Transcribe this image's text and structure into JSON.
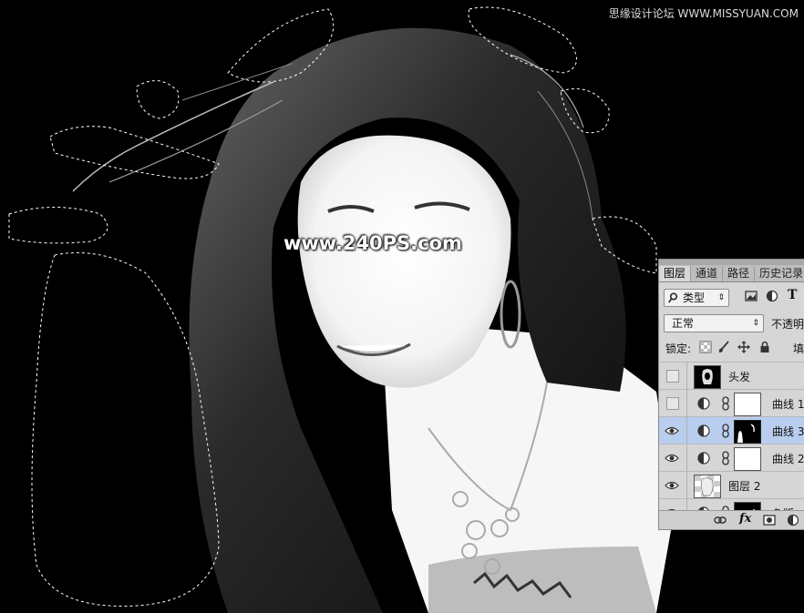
{
  "watermarks": {
    "site": "思缘设计论坛 WWW.MISSYUAN.COM",
    "center": "www.240PS.com"
  },
  "layers_panel": {
    "tabs": [
      {
        "label": "图层",
        "active": true
      },
      {
        "label": "通道",
        "active": false
      },
      {
        "label": "路径",
        "active": false
      },
      {
        "label": "历史记录",
        "active": false
      }
    ],
    "filter": {
      "label": "类型",
      "icon": "search-icon"
    },
    "filter_icons": [
      "image-filter-icon",
      "adjustment-filter-icon",
      "type-filter-icon"
    ],
    "blend_mode": "正常",
    "opacity_label": "不透明",
    "lock_label": "锁定:",
    "fill_label": "填",
    "layers": [
      {
        "name": "头发",
        "visible": false,
        "selected": false,
        "kind": "pixel",
        "thumb": "hair-thumbnail"
      },
      {
        "name": "曲线 1",
        "visible": false,
        "selected": false,
        "kind": "curves",
        "thumb": "white-mask"
      },
      {
        "name": "曲线 3",
        "visible": true,
        "selected": true,
        "kind": "curves",
        "thumb": "black-mask"
      },
      {
        "name": "曲线 2",
        "visible": true,
        "selected": false,
        "kind": "curves",
        "thumb": "white-mask"
      },
      {
        "name": "图层 2",
        "visible": true,
        "selected": false,
        "kind": "pixel",
        "thumb": "checker-thumbnail"
      },
      {
        "name": "色版",
        "visible": true,
        "selected": false,
        "kind": "curves",
        "thumb": "black-mask"
      }
    ],
    "bottom_icons": [
      "link-icon",
      "fx-icon",
      "mask-icon",
      "adjustment-icon"
    ],
    "colors": {
      "panel_bg": "#d6d6d6",
      "selected_row": "#b9cdee"
    }
  }
}
